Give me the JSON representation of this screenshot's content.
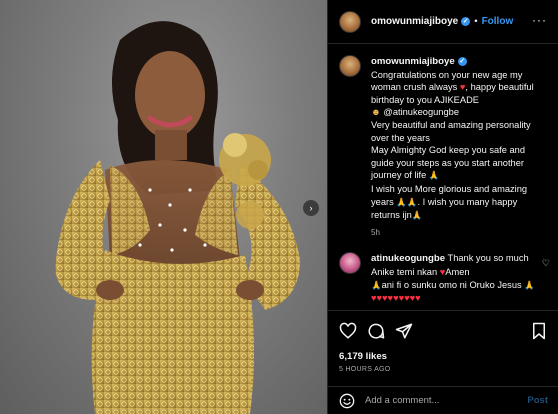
{
  "post": {
    "username": "omowunmiajiboye",
    "follow_label": "Follow",
    "dot": "•",
    "more": "···",
    "next_arrow": "›"
  },
  "caption": {
    "username": "omowunmiajiboye",
    "line1": "Congratulations on your new age my woman crush always ",
    "heart": "♥",
    "line2": ", happy beautiful birthday to you AJIKEADE",
    "emoji_smile": "☻",
    "mention": " @atinukeogungbe",
    "line3": "Very beautiful and amazing personality over the years\nMay Almighty God keep you safe and guide your steps as you start another journey of life ",
    "pray1": "🙏",
    "line4": "\nI wish you More glorious and amazing years ",
    "pray2": "🙏🙏",
    "line5": ". I wish you many happy returns ijn",
    "pray3": "🙏",
    "time_ago": "5h"
  },
  "reply": {
    "username": "atinukeogungbe",
    "text1": " Thank you so much Anike temi nkan ",
    "heart": "♥",
    "text2": "Amen ",
    "pray1": "🙏",
    "text3": "ani fi o sunku omo ni Oruko Jesus ",
    "pray2": "🙏",
    "hearts": " ♥♥♥♥♥♥♥♥♥",
    "like_icon": "♡"
  },
  "actions": {
    "likes": "6,179 likes",
    "timestamp": "5 HOURS AGO"
  },
  "add_comment": {
    "placeholder": "Add a comment...",
    "post_label": "Post"
  },
  "colors": {
    "accent": "#3797f0",
    "heart": "#ff3040",
    "dress_gold": "#c9a64a"
  }
}
